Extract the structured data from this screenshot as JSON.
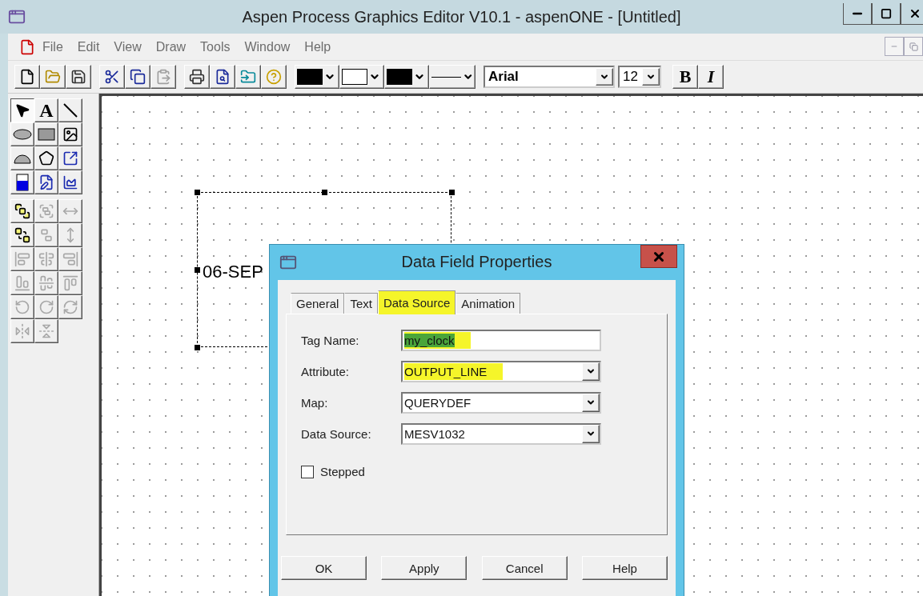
{
  "window": {
    "title": "Aspen Process Graphics Editor V10.1 - aspenONE - [Untitled]"
  },
  "menu": [
    "File",
    "Edit",
    "View",
    "Draw",
    "Tools",
    "Window",
    "Help"
  ],
  "toolbar": {
    "buttons": [
      {
        "disabled": false
      },
      {
        "disabled": false
      },
      {
        "disabled": false
      },
      {
        "disabled": false
      },
      {
        "disabled": false
      },
      {
        "disabled": true
      },
      {
        "disabled": false
      },
      {
        "disabled": false
      },
      {
        "disabled": false
      },
      {
        "disabled": false
      }
    ],
    "colors": [
      {
        "color": "#000000"
      },
      {
        "color": "#ffffff"
      },
      {
        "color": "#000000"
      }
    ],
    "font": "Arial",
    "size": "12",
    "style_buttons": [
      {
        "label": "B",
        "kind": "bold"
      },
      {
        "label": "I",
        "kind": "italic"
      }
    ]
  },
  "palette": {
    "draw_tools": [
      {
        "selected": true
      },
      {
        "selected": false,
        "label": "A"
      },
      {
        "selected": false
      },
      {
        "selected": false
      },
      {
        "selected": false
      },
      {
        "selected": false
      },
      {
        "selected": false
      },
      {
        "selected": false
      },
      {
        "selected": false
      },
      {
        "selected": false
      },
      {
        "selected": false
      },
      {
        "selected": false
      }
    ],
    "arrange_tools": [
      {
        "disabled": false
      },
      {
        "disabled": true
      },
      {
        "disabled": true
      },
      {
        "disabled": false
      },
      {
        "disabled": true
      },
      {
        "disabled": true
      },
      {
        "disabled": true
      },
      {
        "disabled": true
      },
      {
        "disabled": true
      },
      {
        "disabled": true
      },
      {
        "disabled": true
      },
      {
        "disabled": true
      },
      {
        "disabled": true
      },
      {
        "disabled": true
      },
      {
        "disabled": true
      },
      {
        "disabled": true
      },
      {
        "disabled": true
      }
    ]
  },
  "canvas": {
    "data_field": {
      "text": "06-SEP",
      "selected": true
    }
  },
  "dialog": {
    "title": "Data Field Properties",
    "tabs": [
      {
        "label": "General",
        "selected": false,
        "highlighted": false
      },
      {
        "label": "Text",
        "selected": false,
        "highlighted": false
      },
      {
        "label": "Data Source",
        "selected": true,
        "highlighted": true
      },
      {
        "label": "Animation",
        "selected": false,
        "highlighted": false
      }
    ],
    "fields": [
      {
        "label": "Tag Name:",
        "kind": "text",
        "value": "my_clock",
        "highlighted": true,
        "text_selected": true
      },
      {
        "label": "Attribute:",
        "kind": "dropdown",
        "value": "OUTPUT_LINE",
        "highlighted": true,
        "text_selected": false
      },
      {
        "label": "Map:",
        "kind": "dropdown",
        "value": "QUERYDEF",
        "highlighted": false,
        "text_selected": false
      },
      {
        "label": "Data Source:",
        "kind": "dropdown",
        "value": "MESV1032",
        "highlighted": false,
        "text_selected": false
      }
    ],
    "checkbox": {
      "label": "Stepped",
      "checked": false
    },
    "buttons": [
      "OK",
      "Apply",
      "Cancel",
      "Help"
    ]
  }
}
